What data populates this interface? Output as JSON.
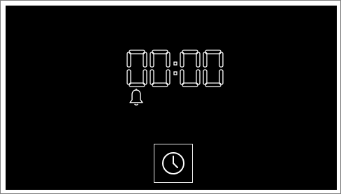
{
  "display": {
    "time": "00:00",
    "digit_color": "#ffffff",
    "background_color": "#000000"
  },
  "icons": {
    "alarm": "bell-icon",
    "clock_button": "clock-icon"
  }
}
